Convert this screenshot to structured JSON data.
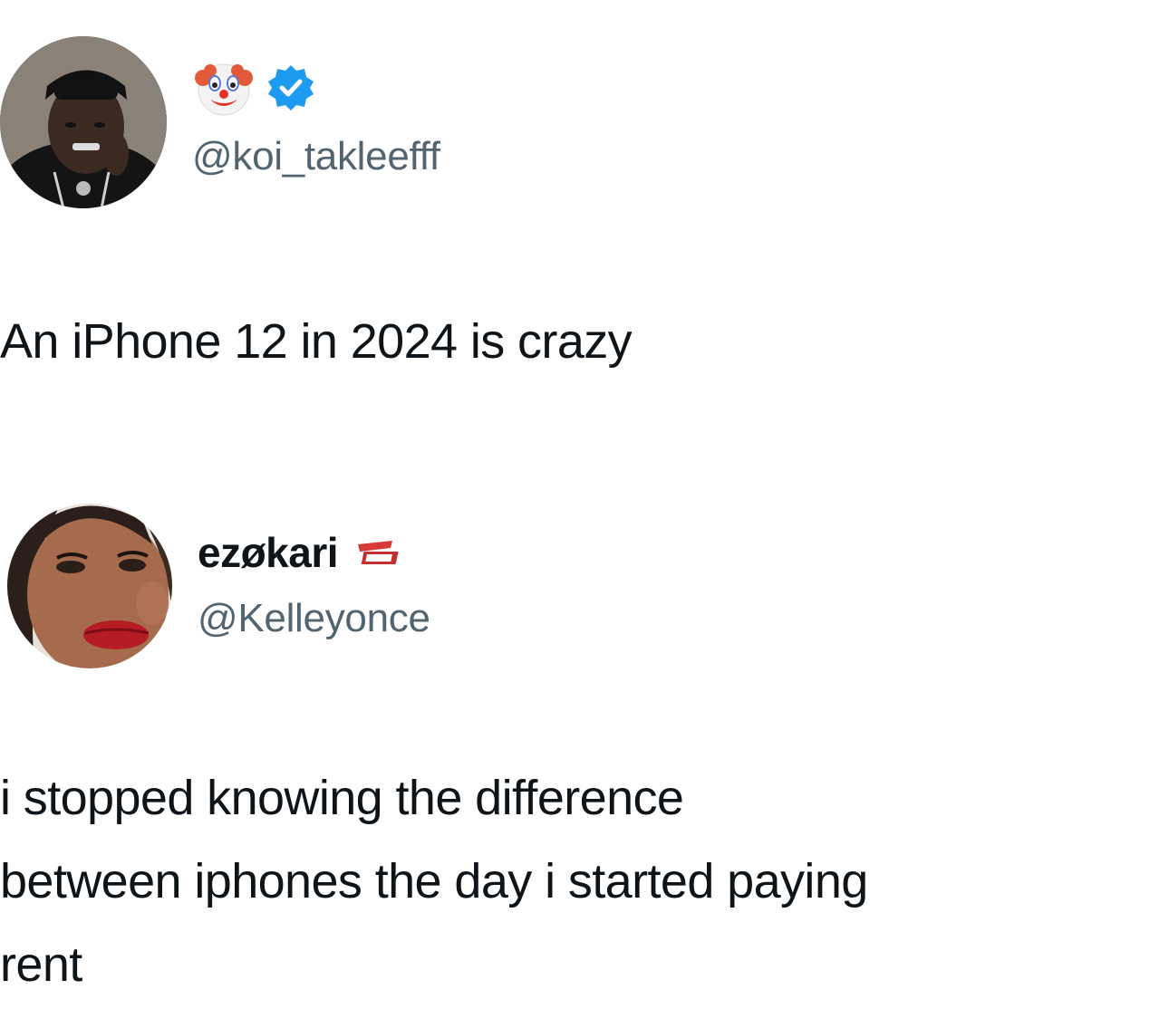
{
  "tweets": [
    {
      "handle": "@koi_takleefff",
      "display_name_icons": [
        "clown-face-icon",
        "verified-badge-icon"
      ],
      "text": "An iPhone 12 in 2024 is crazy"
    },
    {
      "display_name": "ezøkari",
      "handle": "@Kelleyonce",
      "name_badge_icon": "meme-badge-icon",
      "text_lines": [
        "i stopped knowing the difference",
        "between iphones the day i started paying",
        "rent"
      ]
    }
  ],
  "colors": {
    "text": "#0f1419",
    "secondary_text": "#536471",
    "verified": "#1d9bf0",
    "background": "#ffffff"
  }
}
